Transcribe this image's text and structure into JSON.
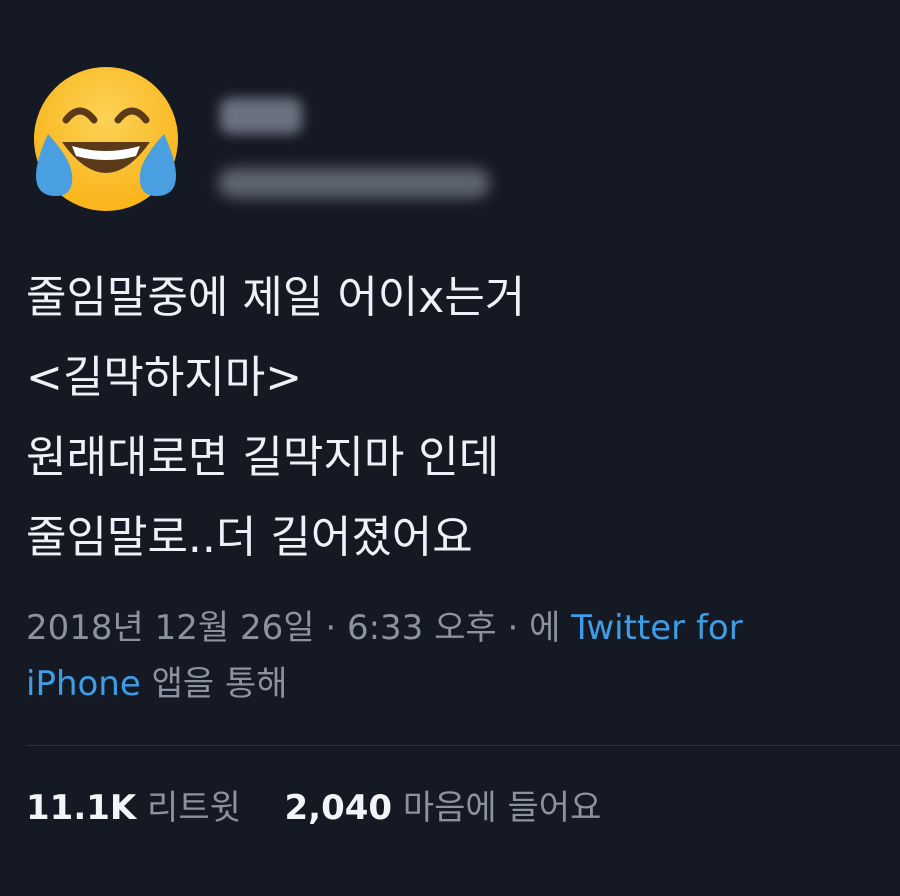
{
  "profile": {
    "avatar_icon": "face-with-tears-of-joy-icon"
  },
  "tweet": {
    "lines": [
      "줄임말중에 제일 어이x는거",
      "<길막하지마>",
      "원래대로면 길막지마 인데",
      "줄임말로..더 길어졌어요"
    ]
  },
  "meta": {
    "date": "2018년 12월 26일",
    "sep1": " · ",
    "time": "6:33 오후",
    "sep2": " · ",
    "via_prefix": "에 ",
    "app_part1": "Twitter for",
    "app_part2": "iPhone",
    "via_suffix": " 앱을 통해"
  },
  "stats": {
    "retweets_count": "11.1K",
    "retweets_label": "리트윗",
    "likes_count": "2,040",
    "likes_label": "마음에 들어요"
  },
  "colors": {
    "background": "#141924",
    "link": "#3d9ee6",
    "muted": "#8a939f"
  }
}
